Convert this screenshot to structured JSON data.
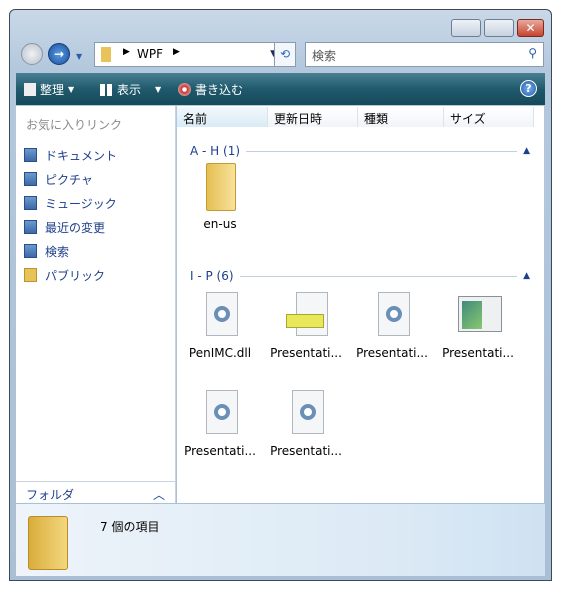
{
  "window": {
    "close": "✕"
  },
  "address": {
    "path": "WPF"
  },
  "search": {
    "placeholder": "検索"
  },
  "toolbar": {
    "organize": "整理",
    "views": "表示",
    "burn": "書き込む"
  },
  "left_pane": {
    "header": "お気に入りリンク",
    "links": [
      "ドキュメント",
      "ピクチャ",
      "ミュージック",
      "最近の変更",
      "検索",
      "パブリック"
    ],
    "folders": "フォルダ"
  },
  "columns": [
    "名前",
    "更新日時",
    "種類",
    "サイズ"
  ],
  "groups": [
    {
      "label": "A - H (1)",
      "items": [
        "en-us"
      ]
    },
    {
      "label": "I - P (6)",
      "items": [
        "PenIMC.dll",
        "Presentati...",
        "Presentati...",
        "Presentati...",
        "Presentati...",
        "Presentati..."
      ]
    }
  ],
  "details": {
    "count": "7 個の項目"
  }
}
